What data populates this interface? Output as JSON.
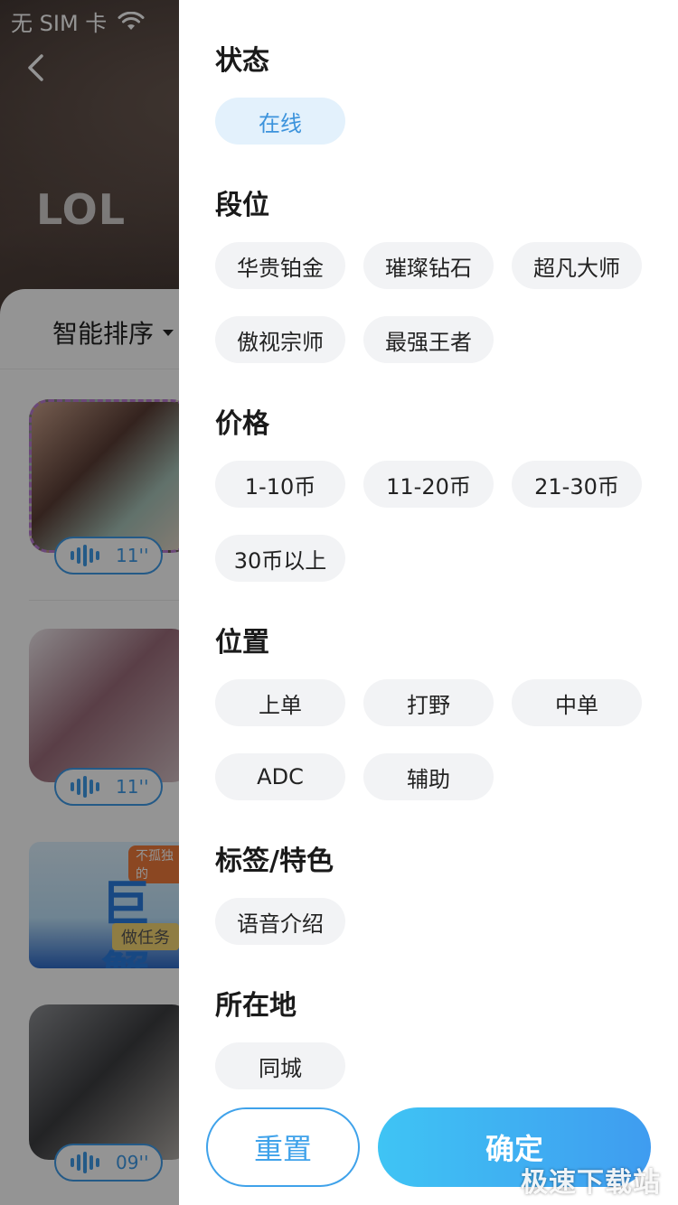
{
  "status_bar": {
    "carrier": "无 SIM 卡",
    "wifi_icon": "wifi-icon",
    "battery_color": "#4cd964"
  },
  "header": {
    "back_icon": "chevron-left-icon",
    "title": "LOL"
  },
  "list": {
    "sort_label": "智能排序",
    "items": [
      {
        "voice_duration": "11''"
      },
      {
        "voice_duration": "11''"
      },
      {
        "voice_duration": "09''"
      }
    ],
    "banner": {
      "title": "巨蟹",
      "subtitle": "做任务",
      "ribbon": "不孤独的"
    }
  },
  "filter": {
    "sections": [
      {
        "title": "状态",
        "chips": [
          {
            "label": "在线",
            "selected": true
          }
        ]
      },
      {
        "title": "段位",
        "chips": [
          {
            "label": "华贵铂金"
          },
          {
            "label": "璀璨钻石"
          },
          {
            "label": "超凡大师"
          },
          {
            "label": "傲视宗师"
          },
          {
            "label": "最强王者"
          }
        ]
      },
      {
        "title": "价格",
        "chips": [
          {
            "label": "1-10币"
          },
          {
            "label": "11-20币"
          },
          {
            "label": "21-30币"
          },
          {
            "label": "30币以上"
          }
        ]
      },
      {
        "title": "位置",
        "chips": [
          {
            "label": "上单"
          },
          {
            "label": "打野"
          },
          {
            "label": "中单"
          },
          {
            "label": "ADC"
          },
          {
            "label": "辅助"
          }
        ]
      },
      {
        "title": "标签/特色",
        "chips": [
          {
            "label": "语音介绍"
          }
        ]
      },
      {
        "title": "所在地",
        "chips": [
          {
            "label": "同城"
          }
        ]
      }
    ],
    "reset_label": "重置",
    "confirm_label": "确定",
    "accent_color": "#3fa2ea"
  },
  "watermark": "极速下载站"
}
